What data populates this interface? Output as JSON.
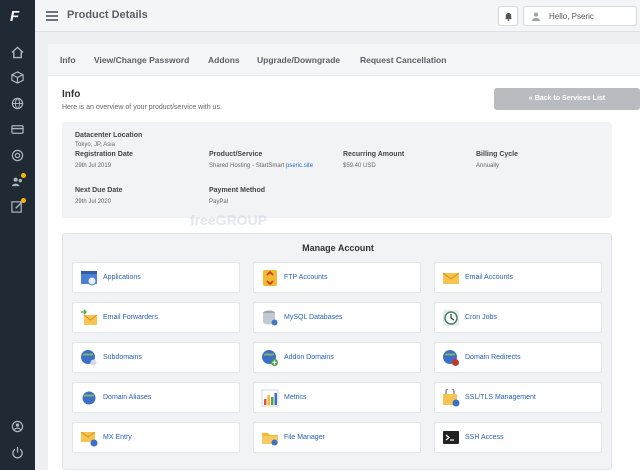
{
  "sidebar": {
    "logo": "F",
    "icons": [
      "home-icon",
      "cube-icon",
      "globe-icon",
      "card-icon",
      "lifebuoy-icon",
      "users-icon",
      "edit-icon",
      "user-circle-icon",
      "power-icon"
    ]
  },
  "topbar": {
    "title": "Product Details",
    "greeting": "Hello, Pseric"
  },
  "tabs": [
    "Info",
    "View/Change Password",
    "Addons",
    "Upgrade/Downgrade",
    "Request Cancellation"
  ],
  "info": {
    "title": "Info",
    "subtitle": "Here is an overview of your product/service with us.",
    "back_button": "« Back to Services List"
  },
  "details": {
    "datacenter_label": "Datacenter Location",
    "datacenter_value": "Tokyo, JP, Asia",
    "registration_label": "Registration Date",
    "registration_value": "29th Jul 2019",
    "product_label": "Product/Service",
    "product_value_prefix": "Shared Hosting - StartSmart ",
    "product_value_link": "pseric.site",
    "recurring_label": "Recurring Amount",
    "recurring_value": "$59.40 USD",
    "billing_label": "Billing Cycle",
    "billing_value": "Annually",
    "nextdue_label": "Next Due Date",
    "nextdue_value": "29th Jul 2020",
    "payment_label": "Payment Method",
    "payment_value": "PayPal"
  },
  "manage": {
    "title": "Manage Account",
    "items": [
      {
        "label": "Applications",
        "icon": "applications-icon"
      },
      {
        "label": "FTP Accounts",
        "icon": "ftp-icon"
      },
      {
        "label": "Email Accounts",
        "icon": "email-icon"
      },
      {
        "label": "Email Forwarders",
        "icon": "email-forwarders-icon"
      },
      {
        "label": "MySQL Databases",
        "icon": "database-icon"
      },
      {
        "label": "Cron Jobs",
        "icon": "clock-icon"
      },
      {
        "label": "Subdomains",
        "icon": "subdomains-icon"
      },
      {
        "label": "Addon Domains",
        "icon": "addon-domains-icon"
      },
      {
        "label": "Domain Redirects",
        "icon": "domain-redirects-icon"
      },
      {
        "label": "Domain Aliases",
        "icon": "domain-aliases-icon"
      },
      {
        "label": "Metrics",
        "icon": "metrics-icon"
      },
      {
        "label": "SSL/TLS Management",
        "icon": "ssl-icon"
      },
      {
        "label": "MX Entry",
        "icon": "mx-entry-icon"
      },
      {
        "label": "File Manager",
        "icon": "folder-icon"
      },
      {
        "label": "SSH Access",
        "icon": "terminal-icon"
      }
    ]
  },
  "watermark": "freeGROUP",
  "colors": {
    "sidebar": "#1f2a35",
    "link": "#2a62b0",
    "back_button": "#b8bcc1",
    "notification_dot": "#f5b800"
  }
}
